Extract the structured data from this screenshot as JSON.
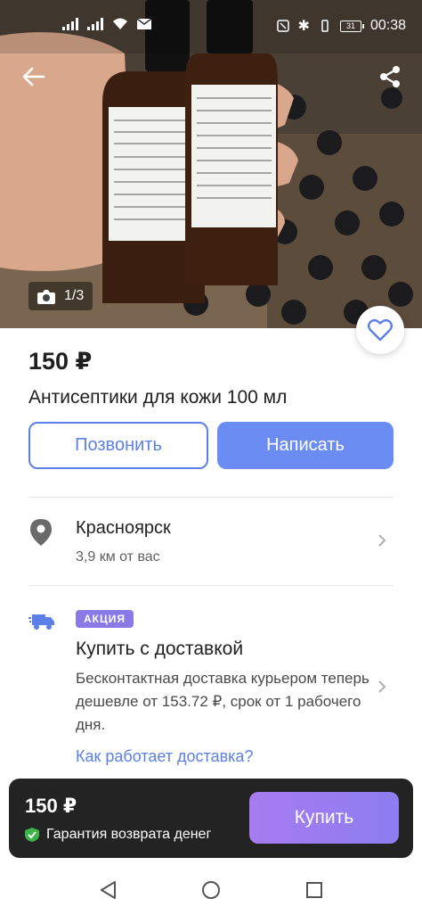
{
  "status_bar": {
    "time": "00:38",
    "battery": "31"
  },
  "photo": {
    "counter": "1/3"
  },
  "listing": {
    "price": "150 ₽",
    "title": "Антисептики для кожи 100 мл"
  },
  "actions": {
    "call_label": "Позвонить",
    "write_label": "Написать"
  },
  "location": {
    "city": "Красноярск",
    "distance": "3,9 км от вас"
  },
  "delivery": {
    "badge": "АКЦИЯ",
    "title": "Купить с доставкой",
    "description": "Бесконтактная доставка курьером теперь дешевле от 153.72 ₽, срок от 1 рабочего дня.",
    "link": "Как работает доставка?"
  },
  "bottom_bar": {
    "price": "150 ₽",
    "guarantee": "Гарантия возврата денег",
    "buy_label": "Купить"
  },
  "colors": {
    "accent": "#6b8cf2",
    "badge": "#8a7ae8",
    "buy_gradient_start": "#a77cf0",
    "guarantee_check": "#3db34a"
  },
  "icons": [
    "back-arrow-icon",
    "share-icon",
    "camera-icon",
    "heart-icon",
    "location-pin-icon",
    "chevron-right-icon",
    "truck-icon",
    "check-icon",
    "nav-back-icon",
    "nav-home-icon",
    "nav-recent-icon"
  ]
}
